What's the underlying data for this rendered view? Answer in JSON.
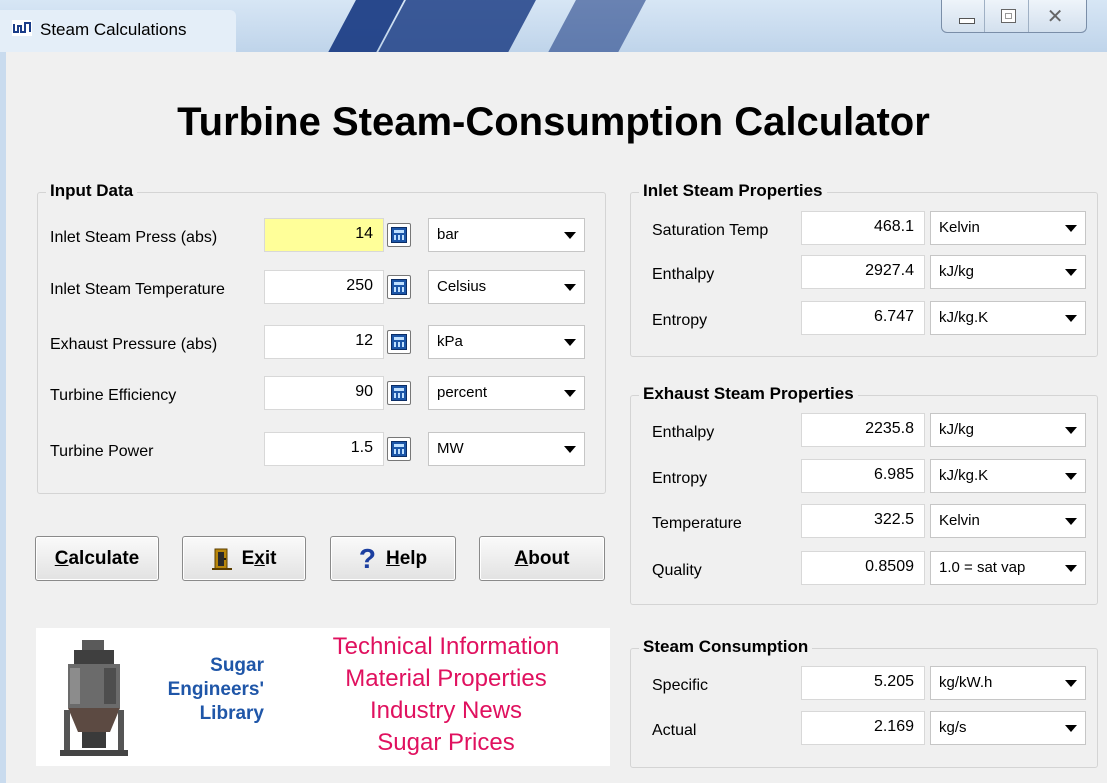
{
  "window": {
    "title": "Steam Calculations"
  },
  "main_title": "Turbine Steam-Consumption Calculator",
  "input_data": {
    "label": "Input Data",
    "rows": [
      {
        "label": "Inlet Steam Press (abs)",
        "value": "14",
        "unit": "bar"
      },
      {
        "label": "Inlet Steam Temperature",
        "value": "250",
        "unit": "Celsius"
      },
      {
        "label": "Exhaust Pressure (abs)",
        "value": "12",
        "unit": "kPa"
      },
      {
        "label": "Turbine Efficiency",
        "value": "90",
        "unit": "percent"
      },
      {
        "label": "Turbine Power",
        "value": "1.5",
        "unit": "MW"
      }
    ]
  },
  "inlet_props": {
    "label": "Inlet Steam Properties",
    "rows": [
      {
        "label": "Saturation Temp",
        "value": "468.1",
        "unit": "Kelvin"
      },
      {
        "label": "Enthalpy",
        "value": "2927.4",
        "unit": "kJ/kg"
      },
      {
        "label": "Entropy",
        "value": "6.747",
        "unit": "kJ/kg.K"
      }
    ]
  },
  "exhaust_props": {
    "label": "Exhaust Steam Properties",
    "rows": [
      {
        "label": "Enthalpy",
        "value": "2235.8",
        "unit": "kJ/kg"
      },
      {
        "label": "Entropy",
        "value": "6.985",
        "unit": "kJ/kg.K"
      },
      {
        "label": "Temperature",
        "value": "322.5",
        "unit": "Kelvin"
      },
      {
        "label": "Quality",
        "value": "0.8509",
        "unit": "1.0 = sat vap"
      }
    ]
  },
  "consumption": {
    "label": "Steam Consumption",
    "rows": [
      {
        "label": "Specific",
        "value": "5.205",
        "unit": "kg/kW.h"
      },
      {
        "label": "Actual",
        "value": "2.169",
        "unit": "kg/s"
      }
    ]
  },
  "buttons": {
    "calculate": {
      "key": "C",
      "rest": "alculate"
    },
    "exit": {
      "pre": "E",
      "key": "x",
      "rest": "it"
    },
    "help": {
      "key": "H",
      "rest": "elp"
    },
    "about": {
      "key": "A",
      "rest": "bout"
    }
  },
  "banner": {
    "library": [
      "Sugar",
      "Engineers'",
      "Library"
    ],
    "links": [
      "Technical Information",
      "Material Properties",
      "Industry News",
      "Sugar Prices"
    ]
  },
  "icons": {
    "app": "steam-app-icon",
    "calc": "calculator-icon",
    "exit": "exit-door-icon",
    "help": "question-mark-icon",
    "dropdown": "chevron-down-icon"
  },
  "colors": {
    "highlight_field": "#ffff99",
    "title_stripe": "#1f3f86",
    "banner_library": "#1f56a8",
    "banner_links": "#e0115f"
  }
}
